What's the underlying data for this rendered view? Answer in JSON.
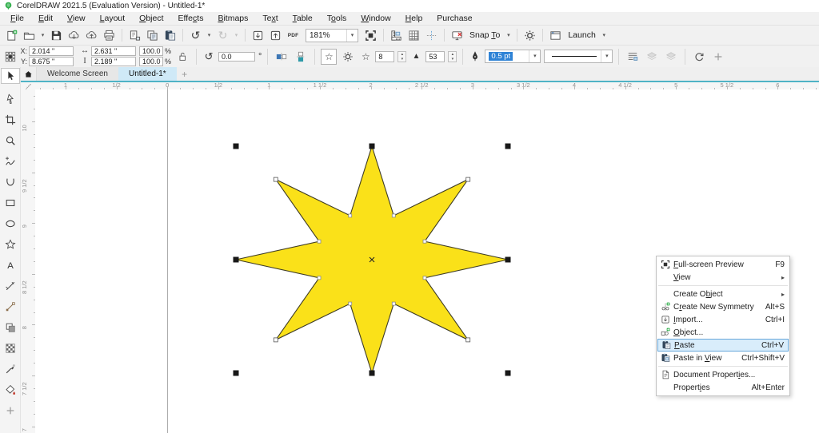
{
  "title_bar": {
    "title": "CorelDRAW 2021.5 (Evaluation Version) - Untitled-1*"
  },
  "menu_bar": {
    "items": [
      {
        "name": "file",
        "label": "<u>F</u>ile"
      },
      {
        "name": "edit",
        "label": "<u>E</u>dit"
      },
      {
        "name": "view",
        "label": "<u>V</u>iew"
      },
      {
        "name": "layout",
        "label": "<u>L</u>ayout"
      },
      {
        "name": "object",
        "label": "<u>O</u>bject"
      },
      {
        "name": "effects",
        "label": "Effe<u>c</u>ts"
      },
      {
        "name": "bitmaps",
        "label": "<u>B</u>itmaps"
      },
      {
        "name": "text",
        "label": "Te<u>x</u>t"
      },
      {
        "name": "table",
        "label": "<u>T</u>able"
      },
      {
        "name": "tools",
        "label": "T<u>o</u>ols"
      },
      {
        "name": "window",
        "label": "<u>W</u>indow"
      },
      {
        "name": "help",
        "label": "<u>H</u>elp"
      },
      {
        "name": "purchase",
        "label": "Purchase"
      }
    ]
  },
  "standard_toolbar": {
    "zoom_level": "181%",
    "snap_to_label": "Snap <u>T</u>o",
    "launch_label": "Launch",
    "pdf_label": "PDF"
  },
  "property_bar": {
    "x_label": "X:",
    "x_value": "2.014 \"",
    "y_label": "Y:",
    "y_value": "8.675 \"",
    "width_value": "2.631 \"",
    "height_value": "2.189 \"",
    "scale_x_value": "100.0",
    "scale_y_value": "100.0",
    "percent_sign": "%",
    "rotation_value": "0.0",
    "degree_sign": "°",
    "points_value": "8",
    "sharpness_value": "53",
    "outline_width_value": "0.5 pt"
  },
  "document_tabs": {
    "welcome_label": "Welcome Screen",
    "active_label": "Untitled-1*",
    "new_tab_label": "+"
  },
  "rulers": {
    "horizontal_labels": [
      "1",
      "1/2",
      "0",
      "1/2",
      "1",
      "1 1/2",
      "2",
      "2 1/2",
      "3",
      "3 1/2",
      "4",
      "4 1/2",
      "5",
      "5 1/2",
      "6"
    ],
    "vertical_labels": [
      "10",
      "9 1/2",
      "9",
      "8 1/2",
      "8",
      "7 1/2",
      "7"
    ]
  },
  "toolbox": {
    "tools": [
      {
        "name": "pick-tool",
        "icon": "tpick",
        "selected": true
      },
      {
        "name": "shape-tool",
        "icon": "tshape"
      },
      {
        "name": "crop-tool",
        "icon": "tcrop"
      },
      {
        "name": "zoom-tool",
        "icon": "tzoom"
      },
      {
        "name": "freehand-tool",
        "icon": "tfree"
      },
      {
        "name": "curve-tool",
        "icon": "tcurve"
      },
      {
        "name": "rectangle-tool",
        "icon": "trect"
      },
      {
        "name": "ellipse-tool",
        "icon": "tellipse"
      },
      {
        "name": "polygon-tool",
        "icon": "tstar"
      },
      {
        "name": "text-tool",
        "icon": "ttext"
      },
      {
        "name": "dimension-tool",
        "icon": "tline"
      },
      {
        "name": "pen-tool",
        "icon": "tpen"
      },
      {
        "name": "drop-shadow-tool",
        "icon": "tshadow"
      },
      {
        "name": "transparency-tool",
        "icon": "ttrans"
      },
      {
        "name": "eyedropper-tool",
        "icon": "tdrop"
      },
      {
        "name": "smart-fill-tool",
        "icon": "tfill"
      },
      {
        "name": "customize-toolbox",
        "icon": "tplus"
      }
    ]
  },
  "canvas": {
    "star": {
      "type": "8-point star",
      "points": 8,
      "fill": "#FAE119",
      "stroke": "#3F3C25"
    }
  },
  "context_menu": {
    "items": [
      {
        "name": "full-screen-preview",
        "label": "<u>F</u>ull-screen Preview",
        "shortcut": "F9",
        "icon": "fullscreen"
      },
      {
        "name": "view",
        "label": "<u>V</u>iew",
        "submenu": true
      },
      {
        "separator": true
      },
      {
        "name": "create-object",
        "label": "Create O<u>b</u>ject",
        "submenu": true
      },
      {
        "name": "create-new-symmetry",
        "label": "C<u>r</u>eate New Symmetry",
        "shortcut": "Alt+S",
        "icon": "symmetry"
      },
      {
        "name": "import",
        "label": "<u>I</u>mport...",
        "shortcut": "Ctrl+I",
        "icon": "importbox"
      },
      {
        "name": "object",
        "label": "<u>O</u>bject...",
        "icon": "objectnew"
      },
      {
        "name": "paste",
        "label": "<u>P</u>aste",
        "shortcut": "Ctrl+V",
        "icon": "paste",
        "highlighted": true
      },
      {
        "name": "paste-in-view",
        "label": "Paste in <u>V</u>iew",
        "shortcut": "Ctrl+Shift+V",
        "icon": "pasteview"
      },
      {
        "separator": true
      },
      {
        "name": "document-properties",
        "label": "Document Propert<u>i</u>es...",
        "icon": "docprops"
      },
      {
        "name": "properties",
        "label": "Propert<u>i</u>es",
        "shortcut": "Alt+Enter"
      }
    ]
  },
  "colors": {
    "accent_teal": "#4FB3C6",
    "active_tab_bg": "#CFE9F7",
    "selection_blue": "#2F83D6",
    "menu_highlight_bg": "#D9EDFB",
    "menu_highlight_border": "#67A7DA",
    "star_fill": "#FAE119",
    "toolbar_bg": "#F1F1F1"
  }
}
